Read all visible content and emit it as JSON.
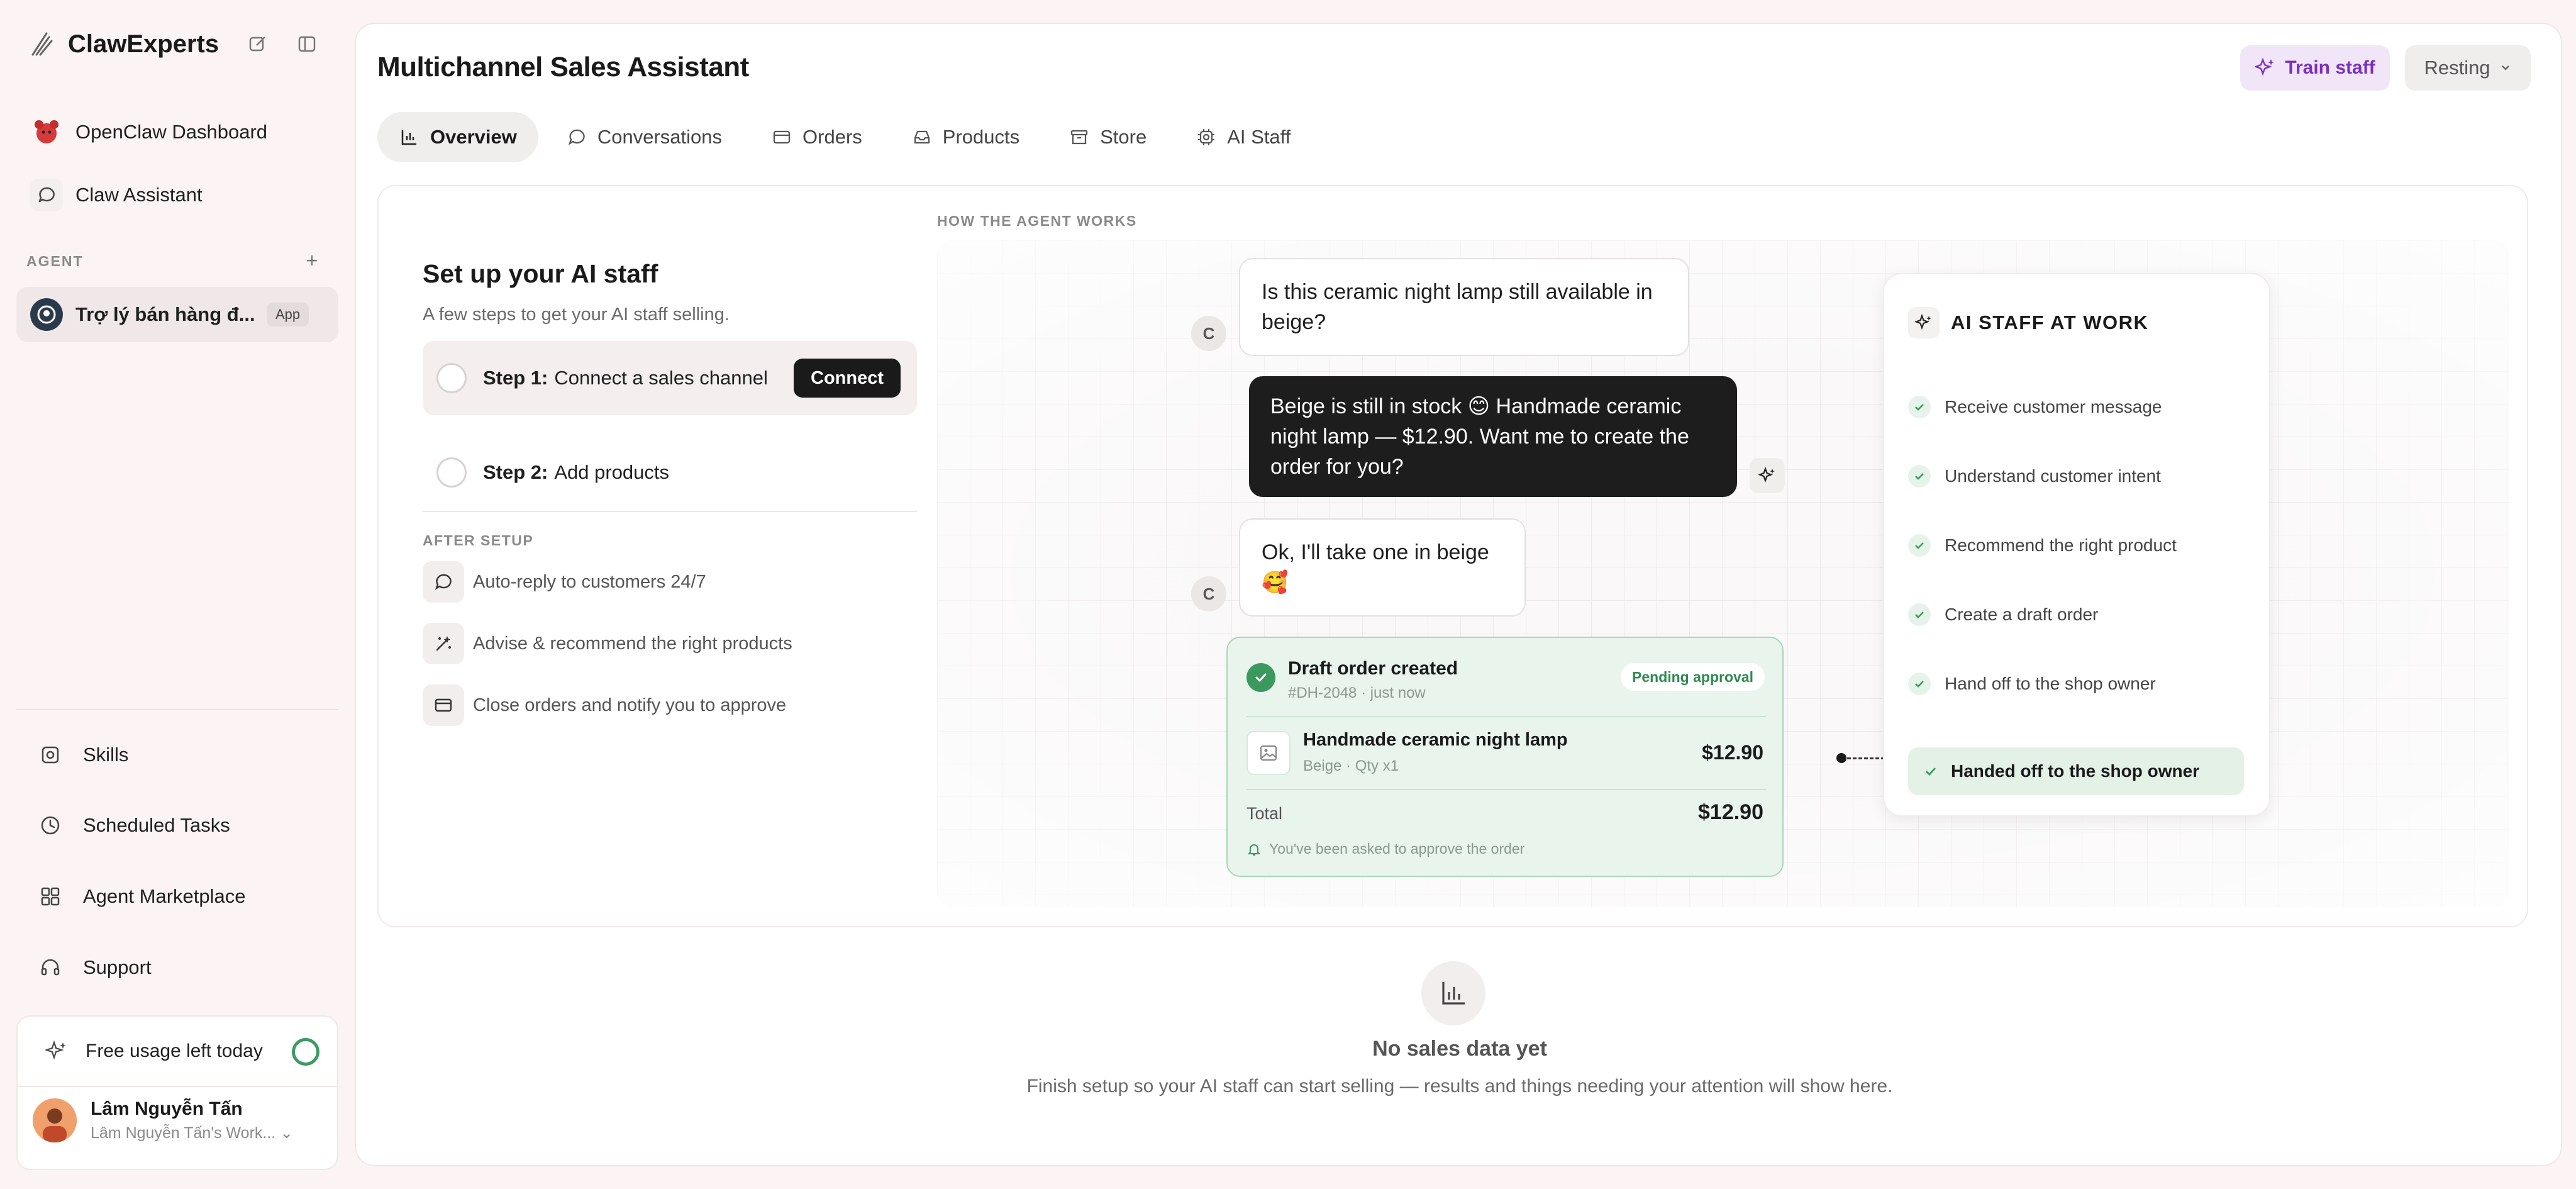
{
  "app": {
    "brand": "ClawExperts"
  },
  "sidebar": {
    "nav": [
      {
        "label": "OpenClaw Dashboard"
      },
      {
        "label": "Claw Assistant"
      }
    ],
    "agent_section_label": "AGENT",
    "agent": {
      "label": "Trợ lý bán hàng đ...",
      "badge": "App"
    },
    "bottom_nav": [
      {
        "label": "Skills",
        "icon": "skills-icon"
      },
      {
        "label": "Scheduled Tasks",
        "icon": "clock-icon"
      },
      {
        "label": "Agent Marketplace",
        "icon": "grid-icon"
      },
      {
        "label": "Support",
        "icon": "headset-icon"
      }
    ],
    "usage_label": "Free usage left today",
    "user": {
      "name": "Lâm Nguyễn Tấn",
      "workspace": "Lâm Nguyễn Tấn's Work..."
    }
  },
  "header": {
    "title": "Multichannel Sales Assistant",
    "train_label": "Train staff",
    "status_label": "Resting"
  },
  "tabs": [
    {
      "label": "Overview",
      "active": true
    },
    {
      "label": "Conversations"
    },
    {
      "label": "Orders"
    },
    {
      "label": "Products"
    },
    {
      "label": "Store"
    },
    {
      "label": "AI Staff"
    }
  ],
  "setup": {
    "title": "Set up your AI staff",
    "subtitle": "A few steps to get your AI staff selling.",
    "steps": [
      {
        "prefix": "Step 1:",
        "text": "Connect a sales channel",
        "action": "Connect"
      },
      {
        "prefix": "Step 2:",
        "text": "Add products"
      }
    ],
    "after_label": "AFTER SETUP",
    "features": [
      "Auto-reply to customers 24/7",
      "Advise & recommend the right products",
      "Close orders and notify you to approve"
    ]
  },
  "demo": {
    "label": "HOW THE AGENT WORKS",
    "customer_initial": "C",
    "messages": {
      "c1": "Is this ceramic night lamp still available in beige?",
      "a1": "Beige is still in stock 😊  Handmade ceramic night lamp — $12.90. Want me to create the order for you?",
      "c2": "Ok, I'll take one in beige 🥰"
    },
    "order": {
      "title": "Draft order created",
      "meta": "#DH-2048 · just now",
      "status": "Pending approval",
      "product": "Handmade ceramic night lamp",
      "product_meta": "Beige · Qty x1",
      "price": "$12.90",
      "total_label": "Total",
      "total": "$12.90",
      "note": "You've been asked to approve the order"
    },
    "staff": {
      "title": "AI STAFF AT WORK",
      "steps": [
        "Receive customer message",
        "Understand customer intent",
        "Recommend the right product",
        "Create a draft order",
        "Hand off to the shop owner"
      ],
      "done": "Handed off to the shop owner"
    }
  },
  "empty": {
    "title": "No sales data yet",
    "subtitle": "Finish setup so your AI staff can start selling — results and things needing your attention will show here."
  },
  "colors": {
    "accent_purple": "#7b2fbe",
    "success_green": "#3a9a5e",
    "dark": "#1d1d1d"
  }
}
